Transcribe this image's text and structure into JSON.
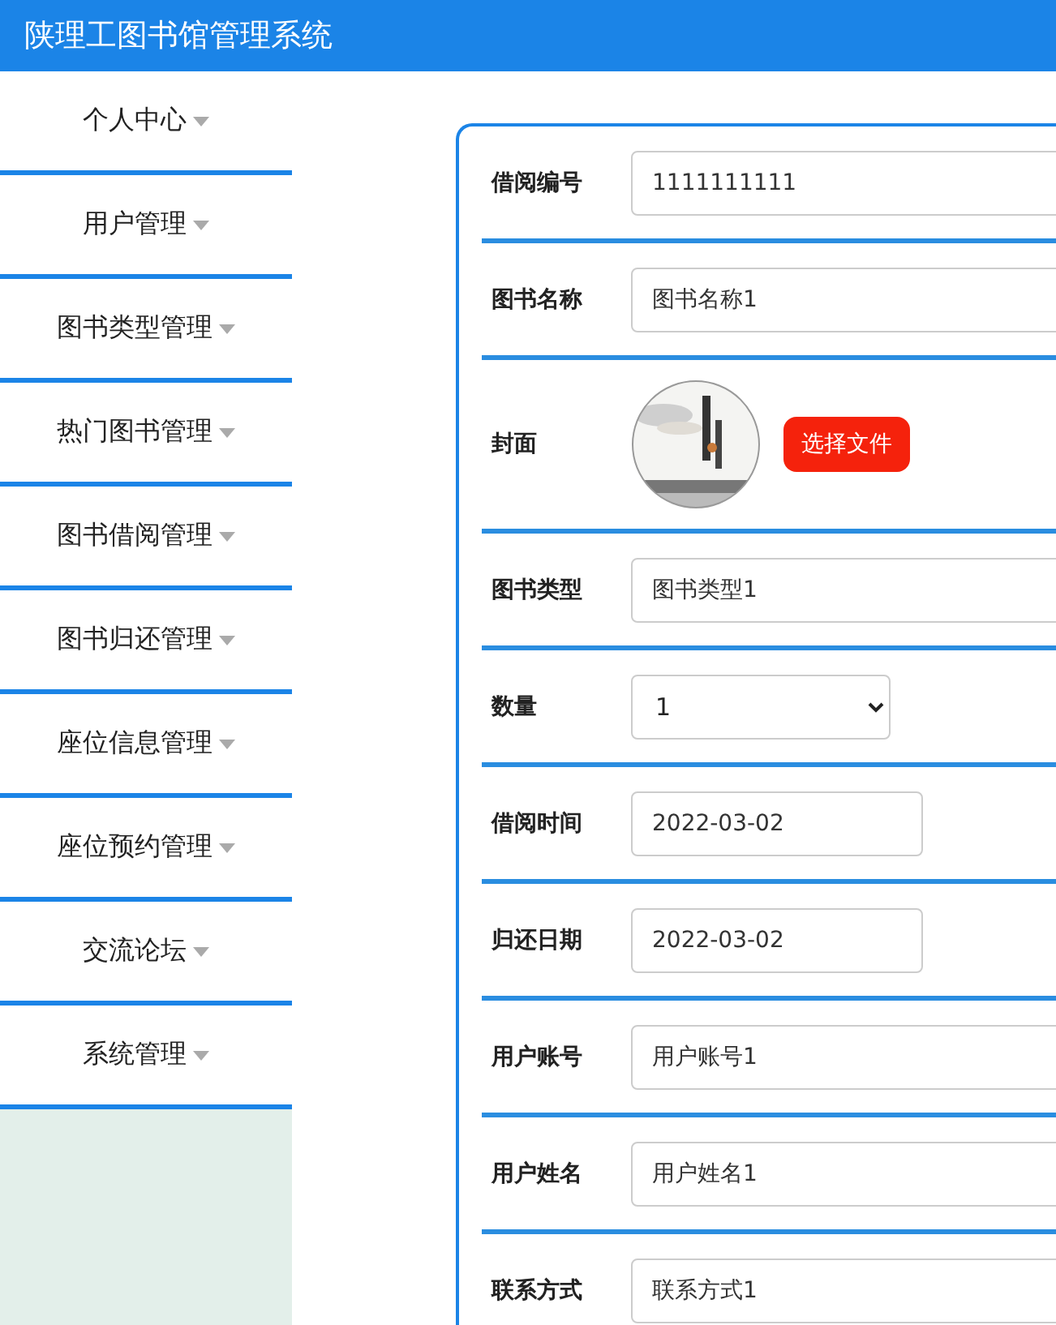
{
  "header": {
    "title": "陕理工图书馆管理系统"
  },
  "sidebar": {
    "items": [
      {
        "label": "个人中心",
        "selected": false
      },
      {
        "label": "用户管理",
        "selected": false
      },
      {
        "label": "图书类型管理",
        "selected": false
      },
      {
        "label": "热门图书管理",
        "selected": false
      },
      {
        "label": "图书借阅管理",
        "selected": false
      },
      {
        "label": "图书归还管理",
        "selected": false
      },
      {
        "label": "座位信息管理",
        "selected": false
      },
      {
        "label": "座位预约管理",
        "selected": false
      },
      {
        "label": "交流论坛",
        "selected": false
      },
      {
        "label": "系统管理",
        "selected": false
      }
    ]
  },
  "form": {
    "rows": [
      {
        "kind": "text",
        "label": "借阅编号",
        "value": "1111111111"
      },
      {
        "kind": "text",
        "label": "图书名称",
        "value": "图书名称1"
      },
      {
        "label": "封面",
        "button": "选择文件"
      },
      {
        "kind": "text",
        "label": "图书类型",
        "value": "图书类型1"
      },
      {
        "kind": "select",
        "label": "数量",
        "value": "1"
      },
      {
        "kind": "date",
        "label": "借阅时间",
        "value": "2022-03-02"
      },
      {
        "kind": "date",
        "label": "归还日期",
        "value": "2022-03-02"
      },
      {
        "kind": "text",
        "label": "用户账号",
        "value": "用户账号1"
      },
      {
        "kind": "text",
        "label": "用户姓名",
        "value": "用户姓名1"
      },
      {
        "kind": "text",
        "label": "联系方式",
        "value": "联系方式1"
      }
    ]
  }
}
